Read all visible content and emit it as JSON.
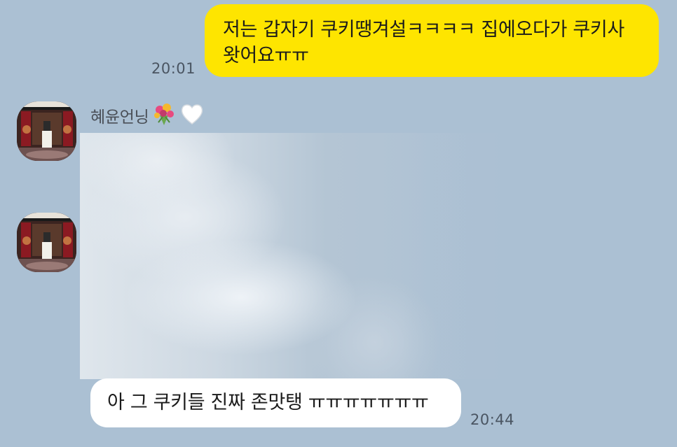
{
  "messages": {
    "outgoing": {
      "text": "저는 갑자기 쿠키땡겨설ㅋㅋㅋㅋ 집에오다가 쿠키사 왓어요ㅠㅠ",
      "time": "20:01"
    },
    "sender": {
      "name": "혜윤언닝",
      "emojis": [
        "bouquet-icon",
        "white-heart-icon"
      ]
    },
    "photo": {
      "state": "blurred"
    },
    "incoming": {
      "text": "아 그 쿠키들 진짜 존맛탱 ㅠㅠㅠㅠㅠㅠㅠ",
      "time": "20:44"
    }
  },
  "colors": {
    "background": "#abc0d3",
    "outgoing_bubble": "#fee500",
    "incoming_bubble": "#ffffff"
  }
}
